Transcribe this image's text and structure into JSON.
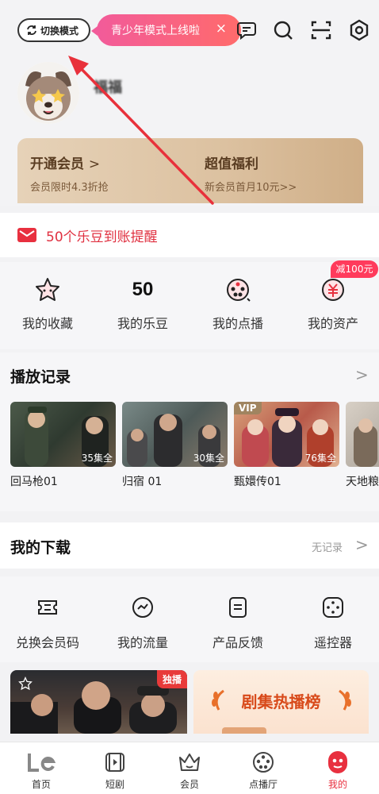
{
  "header": {
    "switch_mode_label": "切换模式",
    "teen_toast_text": "青少年模式上线啦",
    "teen_toast_close": "×",
    "username": "福福",
    "vip_open_title": "开通会员",
    "vip_open_chevron": ">",
    "vip_open_sub": "会员限时4.3折抢",
    "benefit_title": "超值福利",
    "benefit_sub": "新会员首月10元>>"
  },
  "reminder": {
    "text": "50个乐豆到账提醒"
  },
  "stats": {
    "items": [
      {
        "label": "我的收藏",
        "icon": "star-icon"
      },
      {
        "label": "我的乐豆",
        "value": "50"
      },
      {
        "label": "我的点播",
        "icon": "film-reel-icon"
      },
      {
        "label": "我的资产",
        "icon": "coin-icon"
      }
    ],
    "badge": "减100元"
  },
  "history": {
    "title": "播放记录",
    "chevron": ">",
    "items": [
      {
        "title": "回马枪01",
        "episodes": "35集全"
      },
      {
        "title": "归宿 01",
        "episodes": "30集全"
      },
      {
        "title": "甄嬛传01",
        "episodes": "76集全",
        "vip": "VIP"
      },
      {
        "title": "天地粮"
      }
    ]
  },
  "download": {
    "title": "我的下载",
    "status": "无记录",
    "chevron": ">"
  },
  "tools": {
    "items": [
      {
        "label": "兑换会员码",
        "icon": "ticket-icon"
      },
      {
        "label": "我的流量",
        "icon": "traffic-icon"
      },
      {
        "label": "产品反馈",
        "icon": "feedback-icon"
      },
      {
        "label": "遥控器",
        "icon": "remote-icon"
      }
    ]
  },
  "banners": {
    "exclusive": "独播",
    "hot_title": "剧集热播榜"
  },
  "nav": {
    "items": [
      {
        "label": "首页",
        "icon": "le-logo-icon"
      },
      {
        "label": "短剧",
        "icon": "short-drama-icon"
      },
      {
        "label": "会员",
        "icon": "crown-icon"
      },
      {
        "label": "点播厅",
        "icon": "film-reel-icon"
      },
      {
        "label": "我的",
        "icon": "profile-icon"
      }
    ],
    "active_index": 4
  },
  "colors": {
    "accent": "#e8303f",
    "gold": "#dcc1a0",
    "toast_start": "#f25b9a",
    "toast_end": "#ff6b6b"
  }
}
